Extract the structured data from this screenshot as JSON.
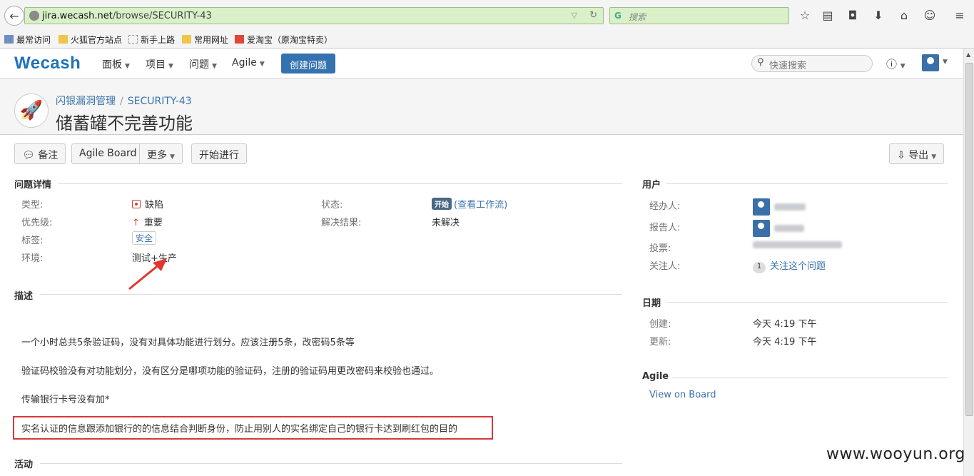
{
  "browser": {
    "url_host": "jira.wecash.net",
    "url_path": "/browse/SECURITY-43",
    "search_placeholder": "搜索",
    "bookmarks": [
      "最常访问",
      "火狐官方站点",
      "新手上路",
      "常用网址",
      "爱淘宝（原淘宝特卖）"
    ]
  },
  "header": {
    "logo": "Wecash",
    "nav": [
      "面板",
      "项目",
      "问题",
      "Agile"
    ],
    "create_label": "创建问题",
    "quick_search_placeholder": "快速搜索"
  },
  "issue": {
    "project": "闪银漏洞管理",
    "key": "SECURITY-43",
    "title": "储蓄罐不完善功能"
  },
  "toolbar": {
    "comment": "备注",
    "agile_board": "Agile Board",
    "more": "更多",
    "start": "开始进行",
    "export": "导出"
  },
  "details": {
    "heading": "问题详情",
    "type_label": "类型:",
    "type_value": "缺陷",
    "priority_label": "优先级:",
    "priority_value": "重要",
    "labels_label": "标签:",
    "labels_value": "安全",
    "env_label": "环境:",
    "env_value": "测试+生产",
    "status_label": "状态:",
    "status_value": "开始",
    "workflow_link": "(查看工作流)",
    "resolution_label": "解决结果:",
    "resolution_value": "未解决"
  },
  "description": {
    "heading": "描述",
    "lines": [
      "一个小时总共5条验证码，没有对具体功能进行划分。应该注册5条，改密码5条等",
      "验证码校验没有对功能划分，没有区分是哪项功能的验证码，注册的验证码用更改密码来校验也通过。",
      "传输银行卡号没有加*",
      "实名认证的信息跟添加银行的的信息结合判断身份，防止用别人的实名绑定自己的银行卡达到刷红包的目的"
    ]
  },
  "activity": {
    "heading": "活动"
  },
  "people": {
    "heading": "用户",
    "assignee_label": "经办人:",
    "reporter_label": "报告人:",
    "votes_label": "投票:",
    "watchers_label": "关注人:",
    "watchers_count": "1",
    "watch_link": "关注这个问题"
  },
  "dates": {
    "heading": "日期",
    "created_label": "创建:",
    "created_value": "今天 4:19 下午",
    "updated_label": "更新:",
    "updated_value": "今天 4:19 下午"
  },
  "agile": {
    "heading": "Agile",
    "link": "View on Board"
  },
  "watermark": "www.wooyun.org",
  "colors": {
    "brand": "#3572b0",
    "link": "#3b73af",
    "highlight": "#d9383a"
  }
}
